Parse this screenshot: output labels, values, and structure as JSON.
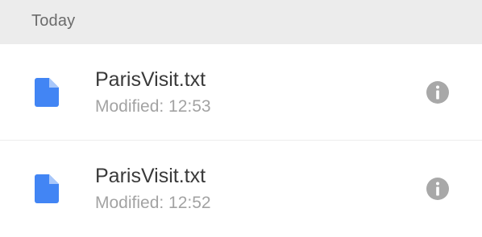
{
  "section": {
    "header": "Today"
  },
  "files": [
    {
      "name": "ParisVisit.txt",
      "modified": "Modified: 12:53",
      "icon": "document-icon",
      "info_icon": "info-icon"
    },
    {
      "name": "ParisVisit.txt",
      "modified": "Modified: 12:52",
      "icon": "document-icon",
      "info_icon": "info-icon"
    }
  ],
  "colors": {
    "header_bg": "#ececec",
    "doc_icon": "#4285f4",
    "info_icon": "#a8a8a8",
    "primary_text": "#3a3a3a",
    "secondary_text": "#a3a3a3"
  }
}
